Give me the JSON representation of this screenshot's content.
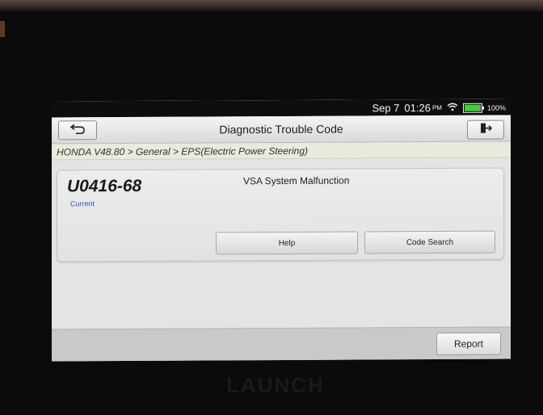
{
  "status": {
    "date": "Sep 7",
    "time": "01:26",
    "ampm": "PM",
    "battery": "100%"
  },
  "header": {
    "title": "Diagnostic Trouble Code",
    "breadcrumb": "HONDA V48.80 > General > EPS(Electric Power Steering)"
  },
  "dtc": {
    "code": "U0416-68",
    "status": "Current",
    "description": "VSA System Malfunction",
    "help_label": "Help",
    "code_search_label": "Code Search"
  },
  "footer": {
    "report_label": "Report"
  },
  "device": {
    "brand": "LAUNCH"
  },
  "colors": {
    "status_text": "#2b57b0",
    "battery": "#3ed13a"
  }
}
